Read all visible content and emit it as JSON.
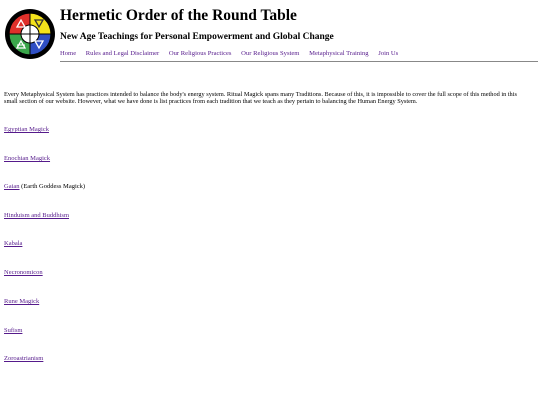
{
  "site": {
    "title": "Hermetic Order of the Round Table",
    "subtitle": "New Age Teachings for Personal Empowerment and Global Change",
    "logo_icon": "elemental-wheel-logo-icon",
    "colors": {
      "link": "#0000ee",
      "visited": "#551a8b",
      "logo_red": "#e0302a",
      "logo_yellow": "#f3e21b",
      "logo_blue": "#2f4fc4",
      "logo_green": "#3aa64a"
    }
  },
  "nav": {
    "items": [
      {
        "label": "Home"
      },
      {
        "label": "Rules and Legal Disclaimer"
      },
      {
        "label": "Our Religious Practices"
      },
      {
        "label": "Our Religious System"
      },
      {
        "label": "Metaphysical Training"
      },
      {
        "label": "Join Us"
      }
    ]
  },
  "intro": {
    "text": "Every Metaphysical System has practices intended to balance the body's energy system.  Ritual Magick spans many Traditions.  Because of this, it is impossible to cover the full scope of this method in this small section of our website.  However, what we have done is list practices from each tradition that we teach as they pertain to balancing the Human Energy System."
  },
  "practices": [
    {
      "label": "Egyptian Magick",
      "note": ""
    },
    {
      "label": "Enochian Magick",
      "note": ""
    },
    {
      "label": "Gaian",
      "note": " (Earth Goddess Magick)"
    },
    {
      "label": "Hinduism and Buddhism",
      "note": ""
    },
    {
      "label": "Kabala",
      "note": ""
    },
    {
      "label": "Necronomicon",
      "note": ""
    },
    {
      "label": "Rune Magick",
      "note": ""
    },
    {
      "label": "Sufism",
      "note": ""
    },
    {
      "label": "Zoroastrianism",
      "note": ""
    }
  ]
}
